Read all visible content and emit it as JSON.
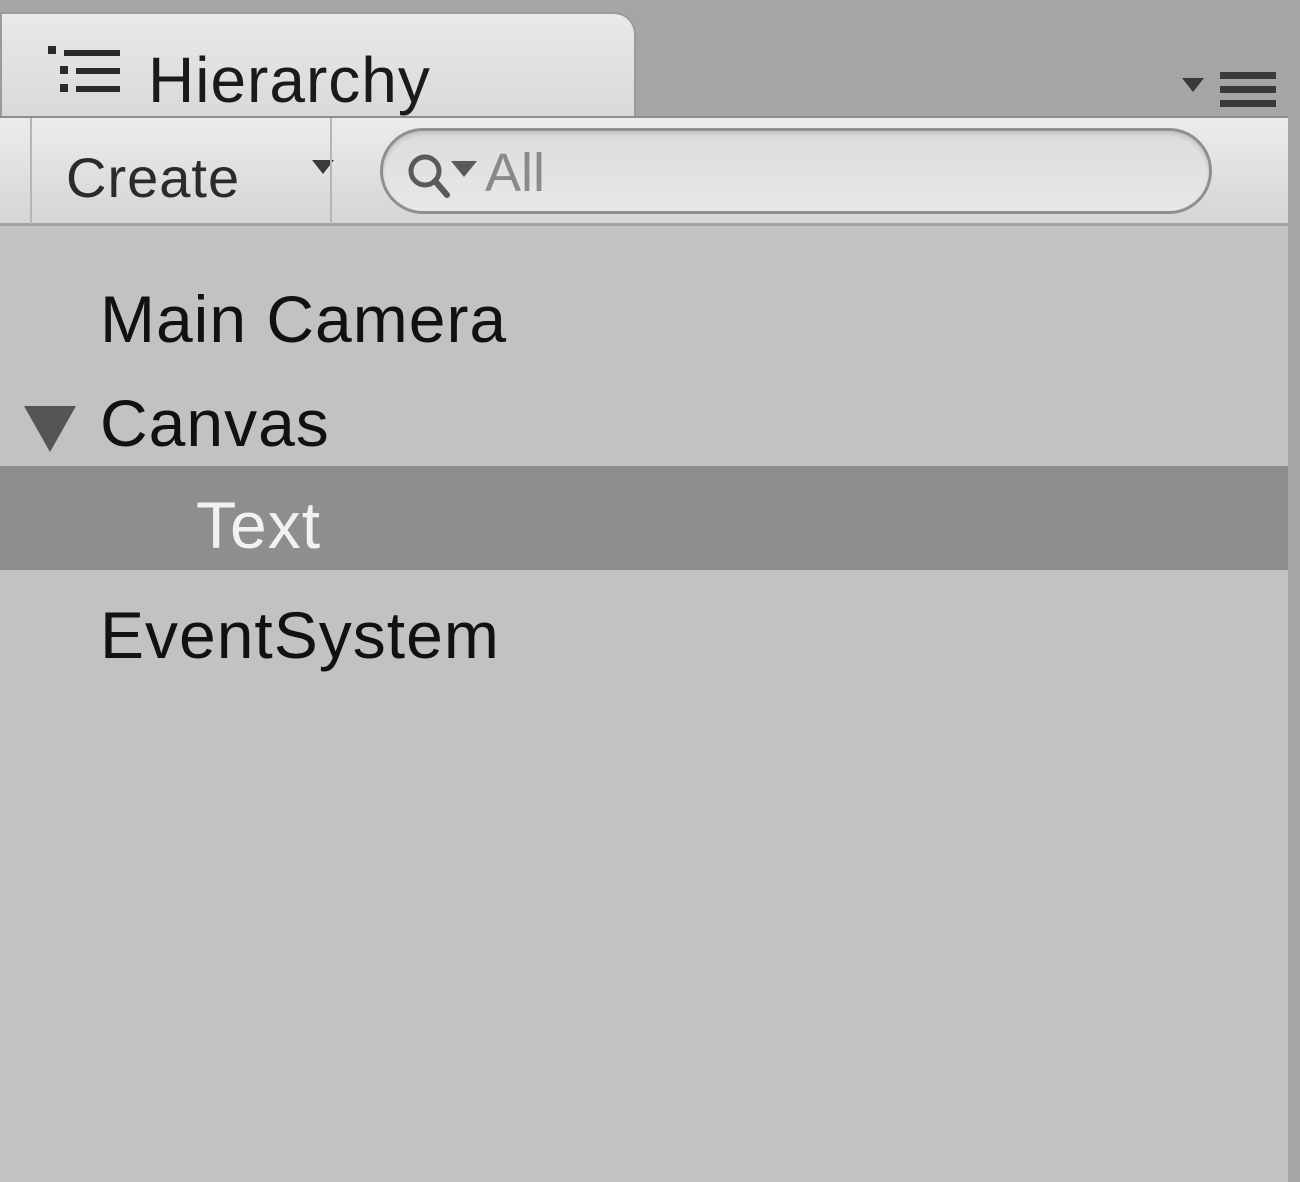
{
  "panel": {
    "tab_title": "Hierarchy",
    "tab_icon": "hierarchy-list-icon",
    "menu_icon": "panel-options-menu-icon"
  },
  "toolbar": {
    "create_label": "Create",
    "create_caret_icon": "dropdown-caret-icon",
    "search": {
      "icon": "search-filter-icon",
      "placeholder": "All",
      "value": ""
    }
  },
  "tree": {
    "items": [
      {
        "label": "Main Camera",
        "depth": 0,
        "expandable": false,
        "selected": false
      },
      {
        "label": "Canvas",
        "depth": 0,
        "expandable": true,
        "expanded": true,
        "selected": false
      },
      {
        "label": "Text",
        "depth": 1,
        "expandable": false,
        "selected": true
      },
      {
        "label": "EventSystem",
        "depth": 0,
        "expandable": false,
        "selected": false
      }
    ]
  },
  "colors": {
    "background": "#a5a5a5",
    "list_background": "#c2c2c2",
    "selection": "#8e8e8e",
    "selected_text": "#f2f2f2",
    "text": "#111111"
  }
}
